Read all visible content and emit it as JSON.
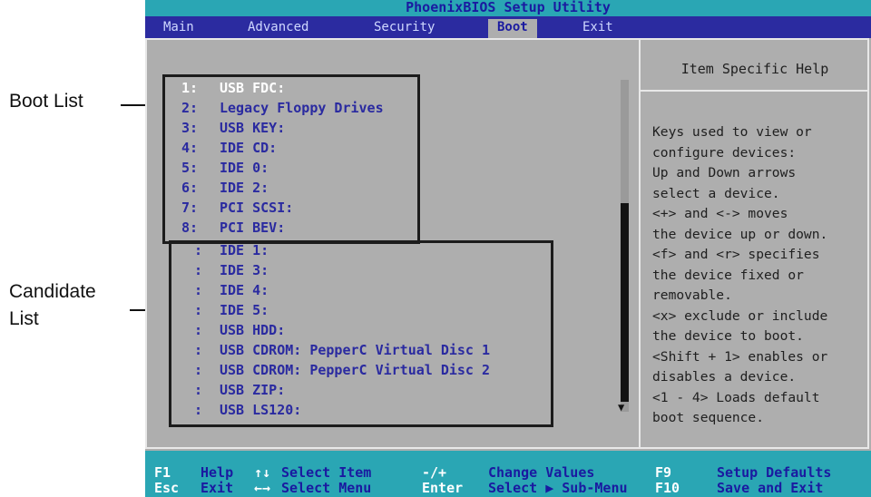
{
  "annotations": {
    "boot_list_label": "Boot List",
    "candidate_list_line1": "Candidate",
    "candidate_list_line2": "List"
  },
  "title": "PhoenixBIOS Setup Utility",
  "menu": [
    "Main",
    "Advanced",
    "Security",
    "Boot",
    "Exit"
  ],
  "active_menu": "Boot",
  "boot_list": [
    {
      "num": "1:",
      "device": "USB FDC:"
    },
    {
      "num": "2:",
      "device": "Legacy Floppy Drives"
    },
    {
      "num": "3:",
      "device": "USB KEY:"
    },
    {
      "num": "4:",
      "device": "IDE CD:"
    },
    {
      "num": "5:",
      "device": "IDE 0:"
    },
    {
      "num": "6:",
      "device": "IDE 2:"
    },
    {
      "num": "7:",
      "device": "PCI SCSI:"
    },
    {
      "num": "8:",
      "device": "PCI BEV:"
    }
  ],
  "candidate_list": [
    {
      "num": ":",
      "device": "IDE 1:"
    },
    {
      "num": ":",
      "device": "IDE 3:"
    },
    {
      "num": ":",
      "device": "IDE 4:"
    },
    {
      "num": ":",
      "device": "IDE 5:"
    },
    {
      "num": ":",
      "device": "USB HDD:"
    },
    {
      "num": ":",
      "device": "USB CDROM: PepperC Virtual Disc 1"
    },
    {
      "num": ":",
      "device": "USB CDROM: PepperC Virtual Disc 2"
    },
    {
      "num": ":",
      "device": "USB ZIP:"
    },
    {
      "num": ":",
      "device": "USB LS120:"
    }
  ],
  "help": {
    "title": "Item Specific Help",
    "text": "Keys used to view or\nconfigure devices:\nUp and Down arrows\nselect a device.\n<+> and <-> moves\nthe device up or down.\n<f> and <r> specifies\nthe device fixed or\nremovable.\n<x> exclude or include\nthe device to boot.\n<Shift + 1> enables or\ndisables a device.\n<1 - 4> Loads default\nboot sequence."
  },
  "footer": {
    "row1": [
      {
        "key": "F1",
        "desc": "Help"
      },
      {
        "key": "↑↓",
        "desc": "Select Item"
      },
      {
        "key": "-/+",
        "desc": "Change Values"
      },
      {
        "key": "F9",
        "desc": "Setup Defaults"
      }
    ],
    "row2": [
      {
        "key": "Esc",
        "desc": "Exit"
      },
      {
        "key": "←→",
        "desc": "Select Menu"
      },
      {
        "key": "Enter",
        "desc": "Select ▶ Sub-Menu"
      },
      {
        "key": "F10",
        "desc": "Save and Exit"
      }
    ]
  },
  "colors": {
    "title_bar": "#2aa6b4",
    "menu_bar": "#2b2ba0",
    "panel": "#aeaeae",
    "item_text": "#2a2aa0",
    "selected_text": "#ffffff"
  }
}
